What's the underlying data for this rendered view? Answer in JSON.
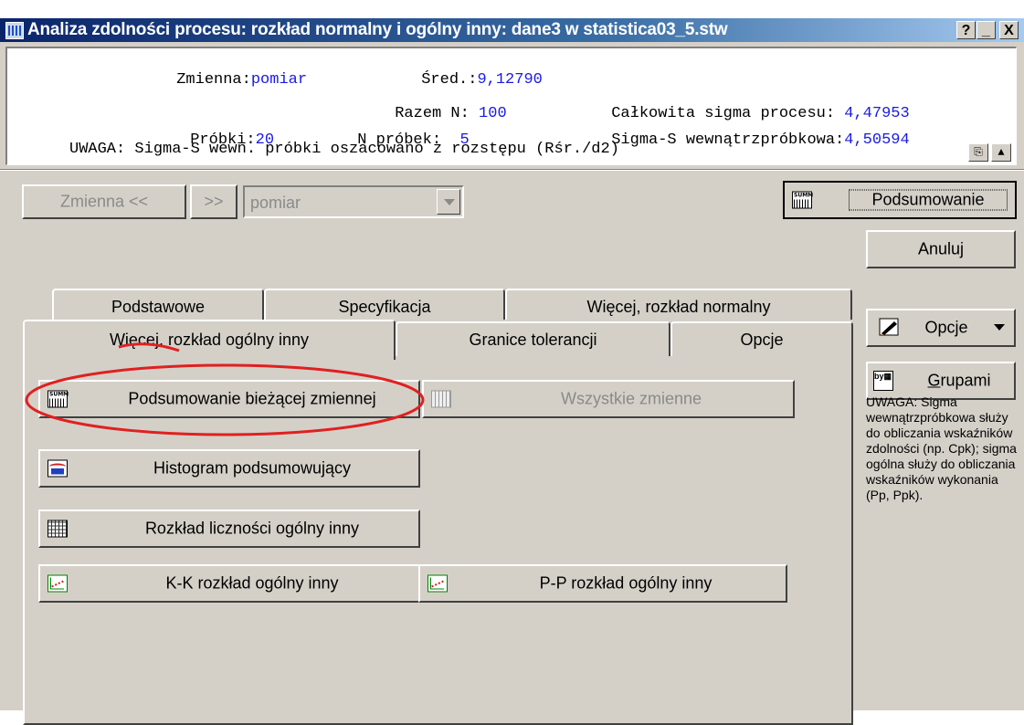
{
  "window": {
    "title": "Analiza zdolności procesu: rozkład normalny i ogólny inny: dane3 w statistica03_5.stw",
    "help_label": "?",
    "minimize_label": "_",
    "close_label": "X"
  },
  "info": {
    "zmienna_label": "Zmienna:",
    "zmienna_value": "pomiar",
    "sred_label": "Śred.:",
    "sred_value": "9,12790",
    "razem_label": "Razem N:",
    "razem_value": "100",
    "calk_label": "Całkowita sigma procesu:",
    "calk_value": "4,47953",
    "probki_label": "Próbki:",
    "probki_value": "20",
    "nprobek_label": "N próbek:",
    "nprobek_value": "5",
    "sigmas_label": "Sigma-S wewnątrzpróbkowa:",
    "sigmas_value": "4,50594",
    "uwaga_text": "UWAGA: Sigma-S wewn. próbki oszacowano z rozstępu (Rśr./d2)"
  },
  "toolbar": {
    "zmienna_prev": "Zmienna <<",
    "next": ">>",
    "variable_value": "pomiar"
  },
  "right": {
    "podsumowanie": "Podsumowanie",
    "anuluj": "Anuluj",
    "opcje": "Opcje",
    "grupami": "Grupami",
    "note": "UWAGA: Sigma wewnątrzpróbkowa służy do obliczania wskaźników zdolności (np. Cpk); sigma ogólna służy do obliczania wskaźników wykonania (Pp, Ppk)."
  },
  "tabs": {
    "row1": [
      "Podstawowe",
      "Specyfikacja",
      "Więcej, rozkład normalny"
    ],
    "row2": [
      "Więcej, rozkład ogólny inny",
      "Granice tolerancji",
      "Opcje"
    ]
  },
  "panel": {
    "btn_summary_current": "Podsumowanie bieżącej zmiennej",
    "btn_all_variables": "Wszystkie zmienne",
    "btn_histogram": "Histogram podsumowujący",
    "btn_freq": "Rozkład liczności ogólny inny",
    "btn_kk": "K-K rozkład ogólny inny",
    "btn_pp": "P-P rozkład ogólny inny"
  },
  "colors": {
    "highlight_ellipse": "#e02020",
    "value_blue": "#1a1ae6"
  }
}
